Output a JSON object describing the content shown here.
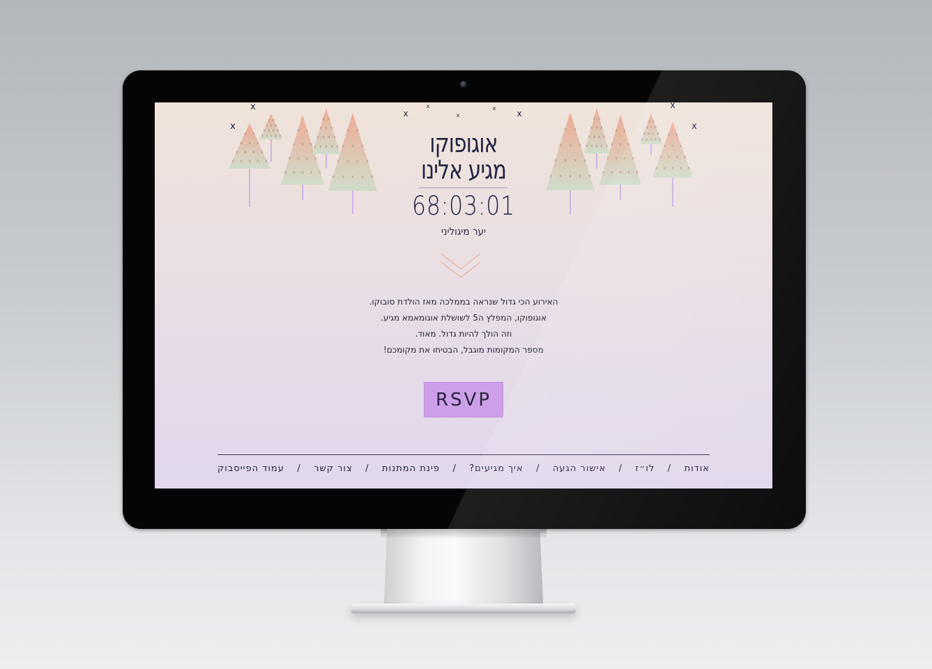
{
  "event": {
    "title_line1": "אוגופוקו",
    "title_line2": "מגיע אלינו",
    "countdown": "68:03:01",
    "host": "יער מיגוליני"
  },
  "description": {
    "lines": [
      "האירוע הכי גדול שנראה בממלכה מאז הולדת סובוקו.",
      "אוגופוקו, המפלץ ה5 לשושלת אוגומאמא מגיע.",
      "וזה הולך להיות גדול. מאוד.",
      "מספר המקומות מוגבל, הבטיחו את מקומכם!"
    ]
  },
  "rsvp_label": "RSVP",
  "nav": {
    "separator": "/",
    "items": [
      "אודות",
      "לו״ז",
      "אישור הגעה",
      "איך מגיעים?",
      "פינת המתנות",
      "צור קשר",
      "עמוד הפייסבוק"
    ]
  },
  "decorations": {
    "mark": "x"
  },
  "colors": {
    "accent": "#cc9fe8",
    "text_dark": "#1d2240",
    "tree_top": "#eea58e",
    "tree_bottom": "#cfdcc8",
    "trunk": "#c9a3ea"
  }
}
